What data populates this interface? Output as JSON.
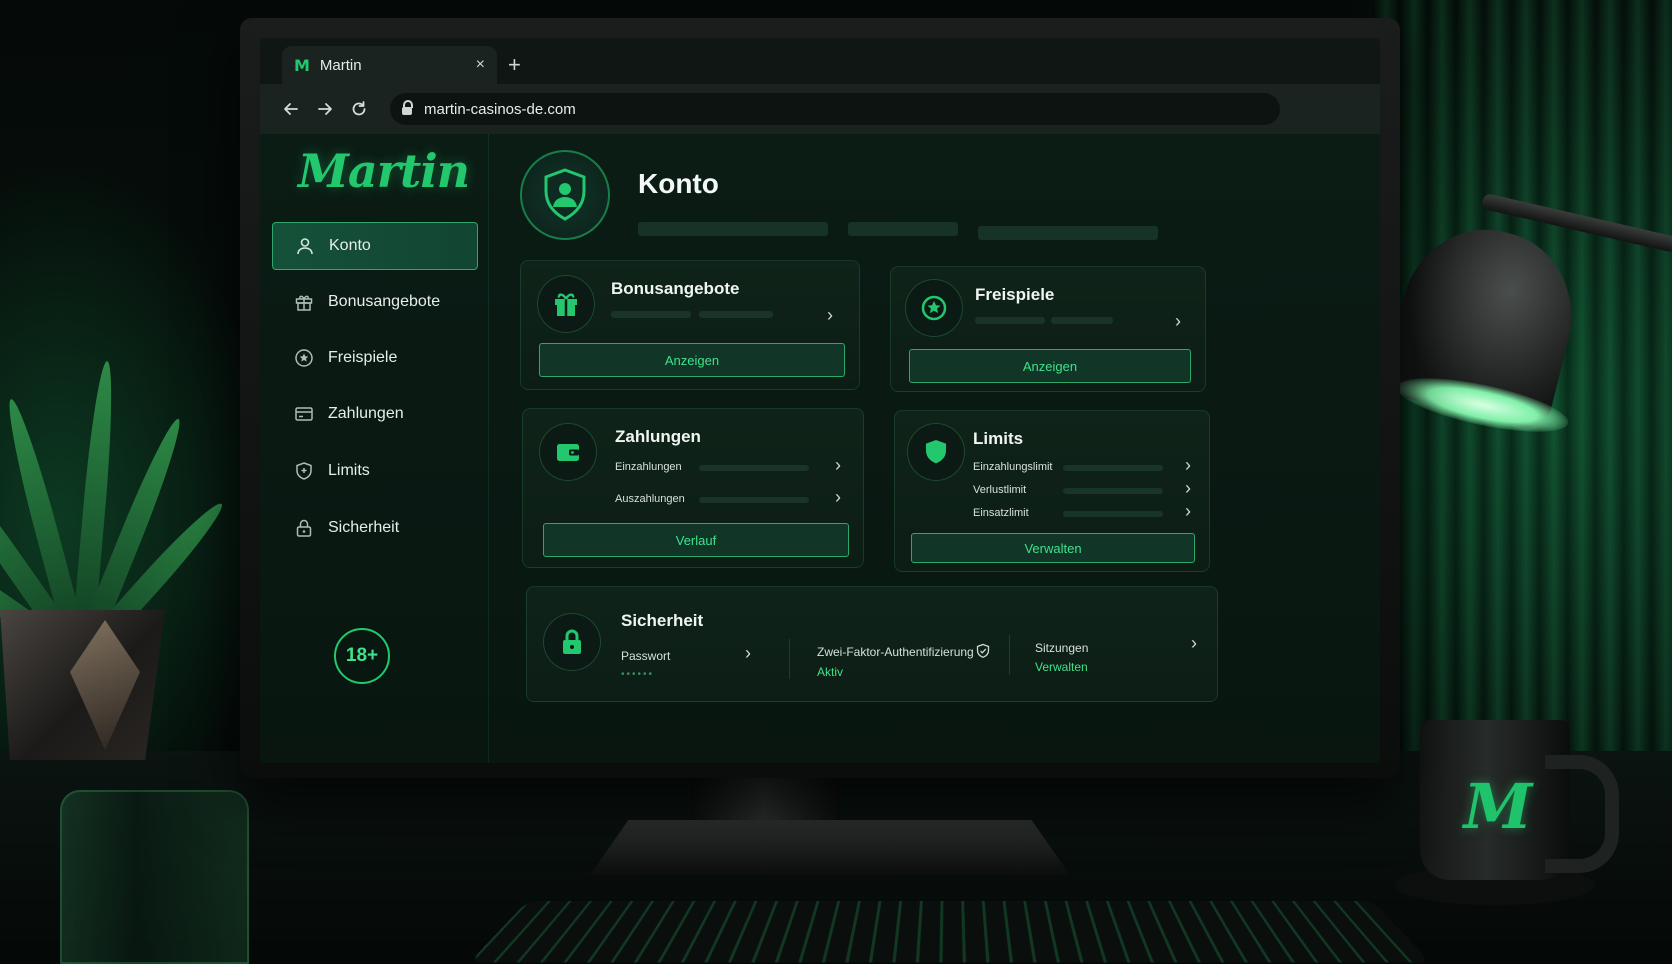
{
  "browser": {
    "tab_title": "Martin",
    "favicon": "M",
    "close_symbol": "×",
    "new_tab_symbol": "+",
    "url": "martin-casinos-de.com"
  },
  "brand": {
    "logo": "Martin",
    "accent": "#22c76e",
    "mug_letter": "M"
  },
  "sidebar": {
    "items": [
      {
        "label": "Konto",
        "icon": "user-icon",
        "active": true
      },
      {
        "label": "Bonusangebote",
        "icon": "gift-icon"
      },
      {
        "label": "Freispiele",
        "icon": "star-circle-icon"
      },
      {
        "label": "Zahlungen",
        "icon": "card-icon"
      },
      {
        "label": "Limits",
        "icon": "shield-icon"
      },
      {
        "label": "Sicherheit",
        "icon": "lock-icon"
      }
    ],
    "age_badge": "18+"
  },
  "main": {
    "title": "Konto",
    "cards": {
      "bonus": {
        "title": "Bonusangebote",
        "button": "Anzeigen"
      },
      "freispiele": {
        "title": "Freispiele",
        "button": "Anzeigen"
      },
      "zahlungen": {
        "title": "Zahlungen",
        "rows": [
          "Einzahlungen",
          "Auszahlungen"
        ],
        "button": "Verlauf"
      },
      "limits": {
        "title": "Limits",
        "rows": [
          "Einzahlungslimit",
          "Verlustlimit",
          "Einsatzlimit"
        ],
        "button": "Verwalten"
      },
      "sicherheit": {
        "title": "Sicherheit",
        "password_label": "Passwort",
        "password_mask": "••••••",
        "twofa_label": "Zwei-Faktor-Authentifizierung",
        "twofa_status": "Aktiv",
        "sessions_label": "Sitzungen",
        "sessions_action": "Verwalten"
      }
    }
  }
}
